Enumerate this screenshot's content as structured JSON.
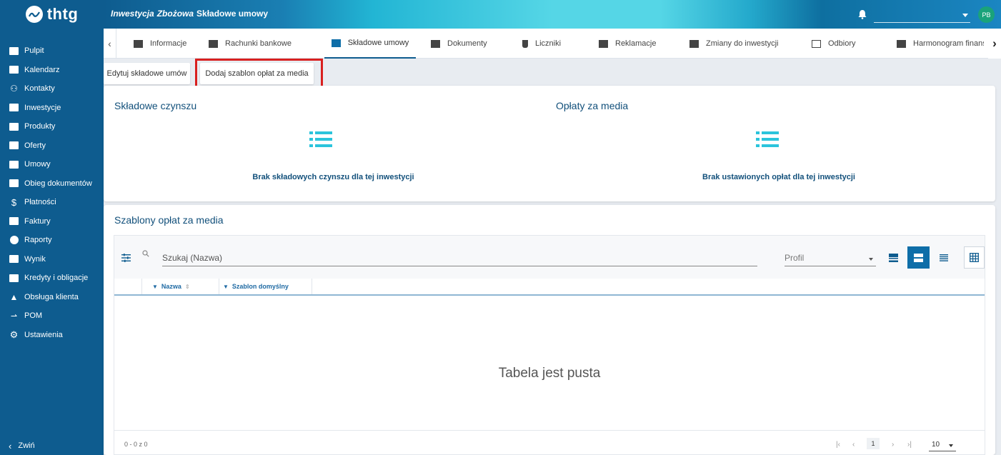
{
  "app": {
    "logo_text": "thtg"
  },
  "sidebar": {
    "items": [
      {
        "label": "Pulpit",
        "icon": "dashboard-icon"
      },
      {
        "label": "Kalendarz",
        "icon": "calendar-icon"
      },
      {
        "label": "Kontakty",
        "icon": "contacts-icon"
      },
      {
        "label": "Inwestycje",
        "icon": "building-icon"
      },
      {
        "label": "Produkty",
        "icon": "products-icon"
      },
      {
        "label": "Oferty",
        "icon": "briefcase-icon"
      },
      {
        "label": "Umowy",
        "icon": "folder-icon"
      },
      {
        "label": "Obieg dokumentów",
        "icon": "monitor-icon"
      },
      {
        "label": "Płatności",
        "icon": "dollar-icon"
      },
      {
        "label": "Faktury",
        "icon": "document-icon"
      },
      {
        "label": "Raporty",
        "icon": "pie-chart-icon"
      },
      {
        "label": "Wynik",
        "icon": "bar-chart-icon"
      },
      {
        "label": "Kredyty i obligacje",
        "icon": "credit-card-icon"
      },
      {
        "label": "Obsługa klienta",
        "icon": "warning-icon"
      },
      {
        "label": "POM",
        "icon": "arrows-icon"
      },
      {
        "label": "Ustawienia",
        "icon": "gear-icon"
      }
    ],
    "collapse_label": "Zwiń"
  },
  "topbar": {
    "crumb1": "Inwestycja",
    "crumb2": "Zbożowa",
    "crumb3": "Składowe umowy",
    "avatar_initials": "PB"
  },
  "tabs": [
    {
      "label": "Informacje",
      "icon": "info-icon"
    },
    {
      "label": "Rachunki bankowe",
      "icon": "bank-icon"
    },
    {
      "label": "Składowe umowy",
      "icon": "folder-icon",
      "active": true
    },
    {
      "label": "Dokumenty",
      "icon": "document-icon"
    },
    {
      "label": "Liczniki",
      "icon": "plug-icon"
    },
    {
      "label": "Reklamacje",
      "icon": "complaint-icon"
    },
    {
      "label": "Zmiany do inwestycji",
      "icon": "changes-icon"
    },
    {
      "label": "Odbiory",
      "icon": "folder-outline-icon"
    },
    {
      "label": "Harmonogram finansowy",
      "icon": "schedule-icon"
    }
  ],
  "actions": {
    "edit_label": "Edytuj składowe umów",
    "add_template_label": "Dodaj szablon opłat za media"
  },
  "summary": {
    "left_title": "Składowe czynszu",
    "left_empty": "Brak składowych czynszu dla tej inwestycji",
    "right_title": "Opłaty za media",
    "right_empty": "Brak ustawionych opłat dla tej inwestycji"
  },
  "templates": {
    "title": "Szablony opłat za media",
    "search_placeholder": "Szukaj (Nazwa)",
    "profile_placeholder": "Profil",
    "columns": [
      "Nazwa",
      "Szablon domyślny"
    ],
    "empty_message": "Tabela jest pusta",
    "range_text": "0 - 0 z 0",
    "current_page": "1",
    "page_size": "10"
  },
  "colors": {
    "sidebar": "#0e5c8f",
    "accent": "#12507b",
    "highlight": "#d9201f",
    "list_icon": "#2bc4dc"
  }
}
